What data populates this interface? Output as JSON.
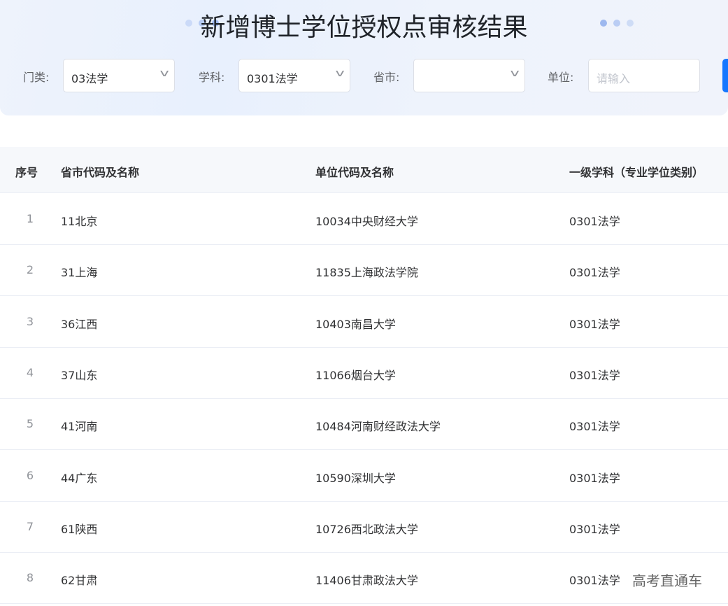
{
  "title": "新增博士学位授权点审核结果",
  "filters": {
    "category": {
      "label": "门类:",
      "value": "03法学"
    },
    "subject": {
      "label": "学科:",
      "value": "0301法学"
    },
    "province": {
      "label": "省市:",
      "value": ""
    },
    "unit": {
      "label": "单位:",
      "placeholder": "请输入"
    }
  },
  "table": {
    "headers": [
      "序号",
      "省市代码及名称",
      "单位代码及名称",
      "一级学科（专业学位类别）"
    ],
    "rows": [
      [
        "1",
        "11北京",
        "10034中央财经大学",
        "0301法学"
      ],
      [
        "2",
        "31上海",
        "11835上海政法学院",
        "0301法学"
      ],
      [
        "3",
        "36江西",
        "10403南昌大学",
        "0301法学"
      ],
      [
        "4",
        "37山东",
        "11066烟台大学",
        "0301法学"
      ],
      [
        "5",
        "41河南",
        "10484河南财经政法大学",
        "0301法学"
      ],
      [
        "6",
        "44广东",
        "10590深圳大学",
        "0301法学"
      ],
      [
        "7",
        "61陕西",
        "10726西北政法大学",
        "0301法学"
      ],
      [
        "8",
        "62甘肃",
        "11406甘肃政法大学",
        "0301法学"
      ]
    ]
  },
  "watermark": "高考直通车",
  "colors": {
    "accent": "#1677ff",
    "panel": "#eef3fc"
  }
}
